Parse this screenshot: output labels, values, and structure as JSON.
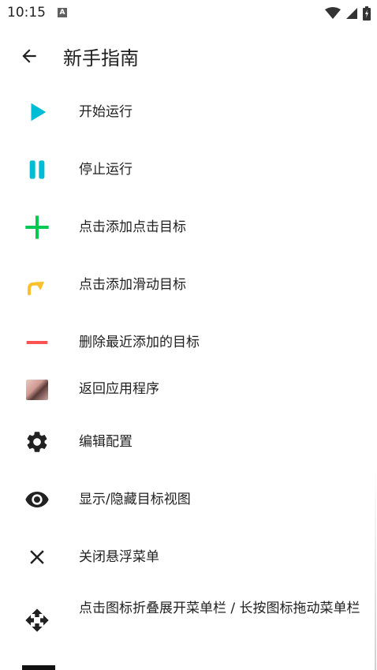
{
  "status_bar": {
    "time": "10:15",
    "notification_glyph": "A"
  },
  "app_bar": {
    "title": "新手指南"
  },
  "items": [
    {
      "icon": "play-icon",
      "label": "开始运行",
      "color": "#00bcd4"
    },
    {
      "icon": "pause-icon",
      "label": "停止运行",
      "color": "#00bcd4"
    },
    {
      "icon": "plus-icon",
      "label": "点击添加点击目标",
      "color": "#00c853"
    },
    {
      "icon": "swipe-arrow-icon",
      "label": "点击添加滑动目标",
      "color": "#fbc02d"
    },
    {
      "icon": "minus-icon",
      "label": "删除最近添加的目标",
      "color": "#ff5252"
    },
    {
      "icon": "app-thumbnail-icon",
      "label": "返回应用程序"
    },
    {
      "icon": "gear-icon",
      "label": "编辑配置",
      "color": "#212121"
    },
    {
      "icon": "eye-icon",
      "label": "显示/隐藏目标视图",
      "color": "#212121"
    },
    {
      "icon": "close-icon",
      "label": "关闭悬浮菜单",
      "color": "#212121"
    },
    {
      "icon": "move-icon",
      "label": "点击图标折叠展开菜单栏 / 长按图标拖动菜单栏",
      "color": "#212121"
    }
  ]
}
